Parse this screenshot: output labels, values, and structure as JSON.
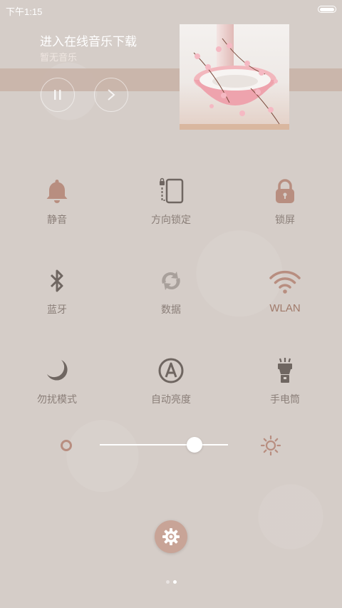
{
  "status_bar": {
    "time": "下午1:15"
  },
  "music": {
    "title": "进入在线音乐下载",
    "artist": "暂无音乐"
  },
  "toggles": [
    {
      "label": "静音",
      "icon": "bell-icon",
      "active": false
    },
    {
      "label": "方向锁定",
      "icon": "rotation-lock-icon",
      "active": false
    },
    {
      "label": "锁屏",
      "icon": "lock-icon",
      "active": false
    },
    {
      "label": "蓝牙",
      "icon": "bluetooth-icon",
      "active": false
    },
    {
      "label": "数据",
      "icon": "data-icon",
      "active": false
    },
    {
      "label": "WLAN",
      "icon": "wifi-icon",
      "active": true
    },
    {
      "label": "勿扰模式",
      "icon": "moon-icon",
      "active": false
    },
    {
      "label": "自动亮度",
      "icon": "auto-brightness-icon",
      "active": false
    },
    {
      "label": "手电筒",
      "icon": "flashlight-icon",
      "active": false
    }
  ],
  "brightness": {
    "level": 0.74
  },
  "pager": {
    "pages": 2,
    "current": 2
  },
  "colors": {
    "background": "#d5cdc8",
    "accent": "#c8a497",
    "icon_dark": "#6f6661",
    "icon_light": "#a8a09b",
    "icon_accent": "#b88e80"
  }
}
